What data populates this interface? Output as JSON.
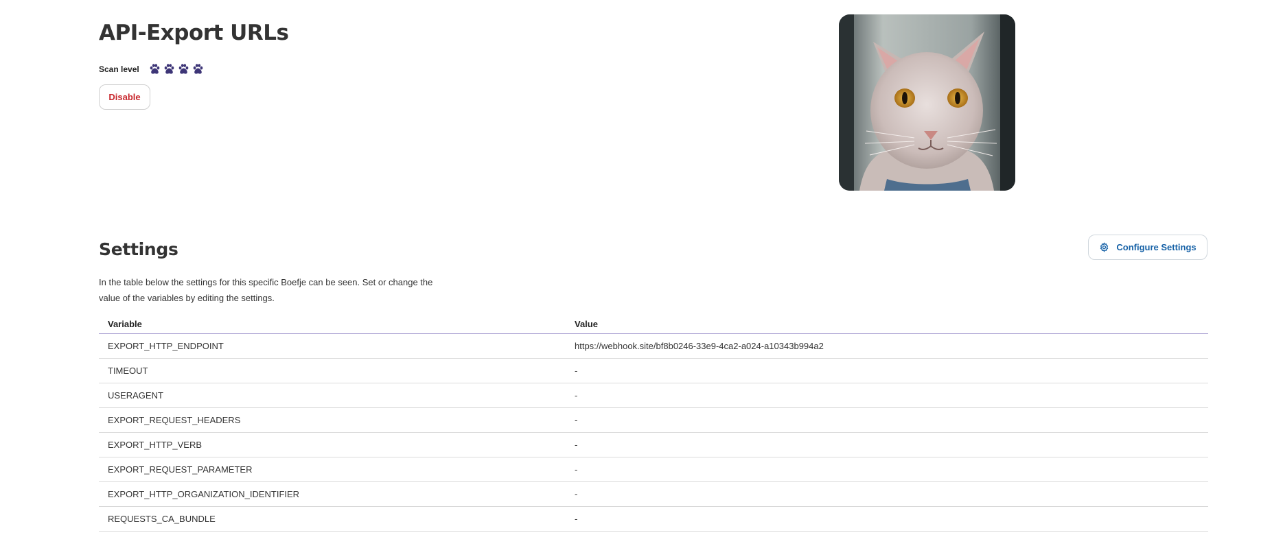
{
  "header": {
    "title": "API-Export URLs",
    "scan_level_label": "Scan level",
    "scan_level": 4,
    "paw_icons": [
      "paw-icon",
      "paw-icon",
      "paw-icon",
      "paw-icon"
    ],
    "paw_color": "#3d3577",
    "disable_label": "Disable",
    "disable_color": "#c8262c"
  },
  "image": {
    "icon": "cat-photo"
  },
  "settings": {
    "title": "Settings",
    "configure_label": "Configure Settings",
    "configure_icon": "gear-icon",
    "accent_color": "#1762a7",
    "description": "In the table below the settings for this specific Boefje can be seen. Set or change the value of the variables by editing the settings.",
    "table": {
      "headers": [
        "Variable",
        "Value"
      ],
      "rows": [
        {
          "variable": "EXPORT_HTTP_ENDPOINT",
          "value": "https://webhook.site/bf8b0246-33e9-4ca2-a024-a10343b994a2"
        },
        {
          "variable": "TIMEOUT",
          "value": "-"
        },
        {
          "variable": "USERAGENT",
          "value": "-"
        },
        {
          "variable": "EXPORT_REQUEST_HEADERS",
          "value": "-"
        },
        {
          "variable": "EXPORT_HTTP_VERB",
          "value": "-"
        },
        {
          "variable": "EXPORT_REQUEST_PARAMETER",
          "value": "-"
        },
        {
          "variable": "EXPORT_HTTP_ORGANIZATION_IDENTIFIER",
          "value": "-"
        },
        {
          "variable": "REQUESTS_CA_BUNDLE",
          "value": "-"
        }
      ]
    }
  }
}
